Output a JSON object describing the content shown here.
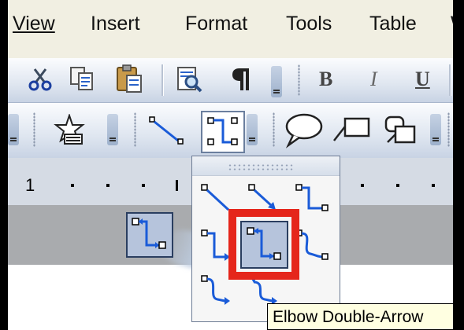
{
  "menubar": {
    "items": [
      {
        "label": "View"
      },
      {
        "label": "Insert"
      },
      {
        "label": "Format"
      },
      {
        "label": "Tools"
      },
      {
        "label": "Table"
      },
      {
        "label": "W"
      }
    ]
  },
  "toolbar_formatting": {
    "bold_label": "B",
    "italic_label": "I",
    "underline_label": "U",
    "icons": [
      "cut-icon",
      "copy-icon",
      "paste-icon",
      "print-preview-icon",
      "show-formatting-icon"
    ]
  },
  "toolbar_drawing": {
    "icons": [
      "draw-menu-icon",
      "line-icon",
      "connector-icon",
      "callout-icon",
      "rectangle-callout-icon",
      "group-shapes-icon"
    ]
  },
  "ruler": {
    "start_number": "1"
  },
  "connector_palette": {
    "shapes": [
      "straight-connector-icon",
      "straight-arrow-connector-icon",
      "straight-double-arrow-connector-icon",
      "elbow-connector-icon",
      "elbow-arrow-connector-icon",
      "elbow-double-arrow-connector-icon",
      "curved-connector-icon",
      "curved-arrow-connector-icon",
      "curved-double-arrow-connector-icon"
    ],
    "selected": "elbow-double-arrow-connector-icon"
  },
  "tooltip": {
    "text": "Elbow Double-Arrow"
  },
  "colors": {
    "highlight": "#e5261b",
    "selection_fill": "#b6c4dc",
    "tooltip_bg": "#ffffe1",
    "toolbar": "#dfe6f0",
    "menubar": "#f1efe2"
  }
}
